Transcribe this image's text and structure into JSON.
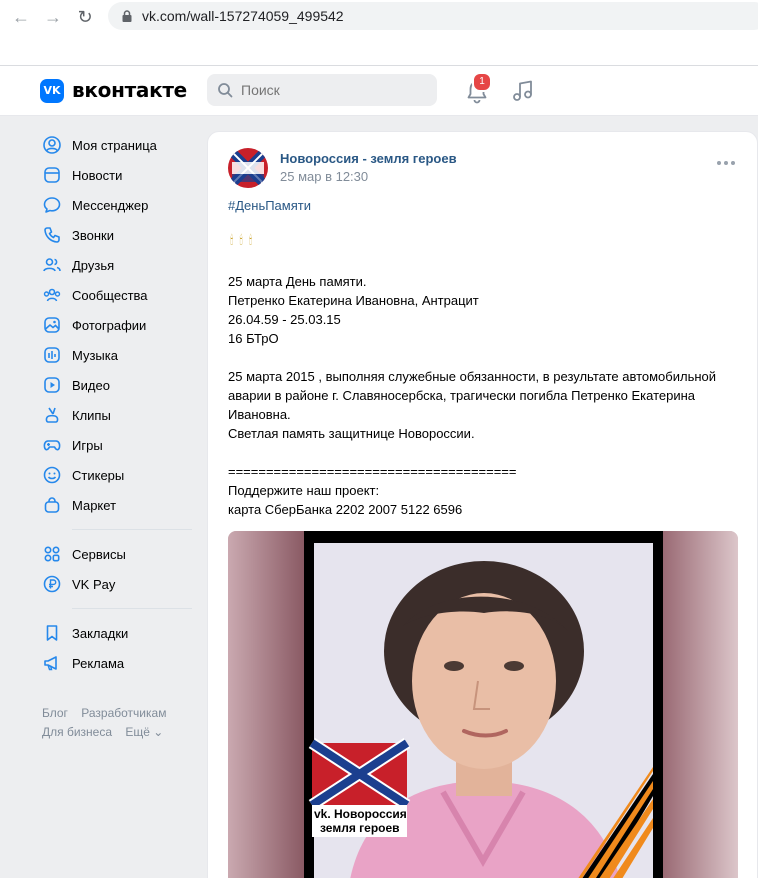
{
  "browser": {
    "back": "←",
    "forward": "→",
    "reload": "↻",
    "url": "vk.com/wall-157274059_499542"
  },
  "header": {
    "logo_letter": "VK",
    "wordmark": "вконтакте",
    "search_placeholder": "Поиск",
    "notifications_count": "1",
    "accent": "#0077ff"
  },
  "sidebar": {
    "items": [
      {
        "label": "Моя страница",
        "icon": "user-circle-icon"
      },
      {
        "label": "Новости",
        "icon": "news-icon"
      },
      {
        "label": "Мессенджер",
        "icon": "message-icon"
      },
      {
        "label": "Звонки",
        "icon": "phone-icon"
      },
      {
        "label": "Друзья",
        "icon": "friends-icon"
      },
      {
        "label": "Сообщества",
        "icon": "communities-icon"
      },
      {
        "label": "Фотографии",
        "icon": "photo-icon"
      },
      {
        "label": "Музыка",
        "icon": "music-icon"
      },
      {
        "label": "Видео",
        "icon": "video-icon"
      },
      {
        "label": "Клипы",
        "icon": "clips-icon"
      },
      {
        "label": "Игры",
        "icon": "games-icon"
      },
      {
        "label": "Стикеры",
        "icon": "stickers-icon"
      },
      {
        "label": "Маркет",
        "icon": "market-icon"
      }
    ],
    "items2": [
      {
        "label": "Сервисы",
        "icon": "services-icon"
      },
      {
        "label": "VK Pay",
        "icon": "vkpay-icon"
      }
    ],
    "items3": [
      {
        "label": "Закладки",
        "icon": "bookmark-icon"
      },
      {
        "label": "Реклама",
        "icon": "ads-icon"
      }
    ],
    "footer": {
      "blog": "Блог",
      "developers": "Разработчикам",
      "business": "Для бизнеса",
      "more": "Ещё ⌄"
    }
  },
  "post": {
    "group_name": "Новороссия - земля героев",
    "date": "25 мар в 12:30",
    "hashtag": "#ДеньПамяти",
    "candles": "🕯🕯🕯",
    "lines": [
      "25 марта День памяти.",
      "Петренко Екатерина Ивановна, Антрацит",
      "26.04.59 - 25.03.15",
      "16 БТрО",
      "",
      "25 марта 2015 , выполняя служебные обязанности, в результате автомобильной",
      "аварии в районе г. Славяносербска, трагически погибла Петренко Екатерина",
      "Ивановна.",
      "Светлая память защитнице Новороссии.",
      "",
      "======================================",
      "Поддержите наш проект:",
      "карта СберБанка 2202 2007 5122 6596"
    ],
    "photo_caption_line1": "vk. Новороссия",
    "photo_caption_line2": "земля героев"
  }
}
